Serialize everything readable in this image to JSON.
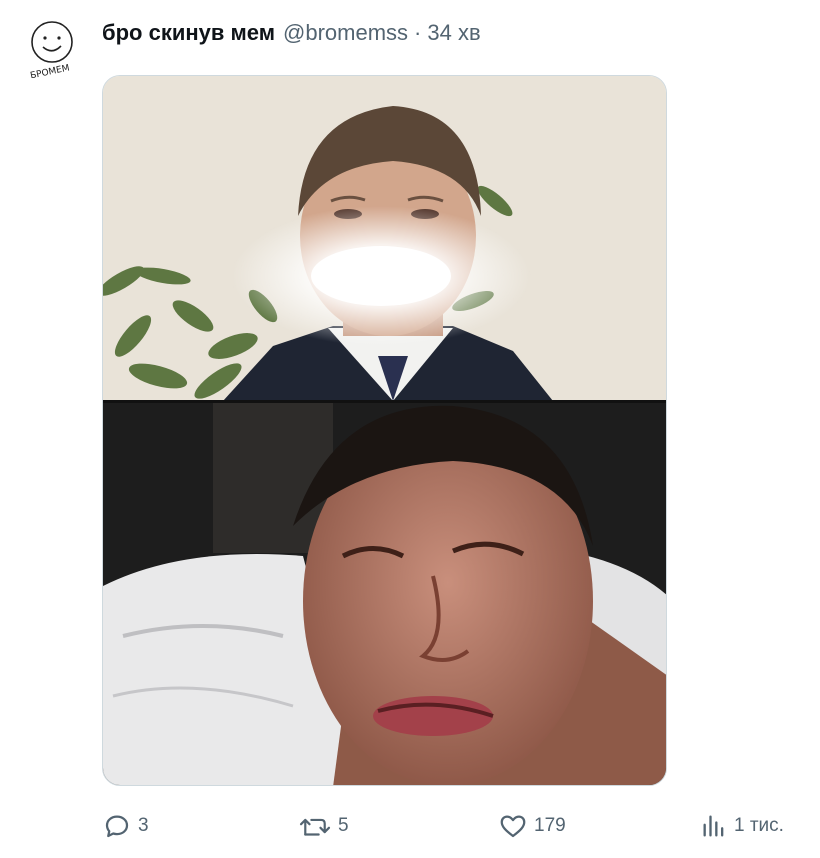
{
  "tweet": {
    "author_name": "бро скинув мем",
    "author_handle": "@bromemss",
    "separator": "·",
    "time": "34 хв",
    "avatar_text": "БРОМЕМ"
  },
  "media": {
    "top_image": "man-in-suit-with-glowing-mouth",
    "bottom_image": "grimacing-man-in-bed"
  },
  "actions": {
    "replies": "3",
    "reposts": "5",
    "likes": "179",
    "views": "1 тис."
  },
  "colors": {
    "text": "#0f1419",
    "secondary": "#536471",
    "border": "#cfd9de"
  }
}
